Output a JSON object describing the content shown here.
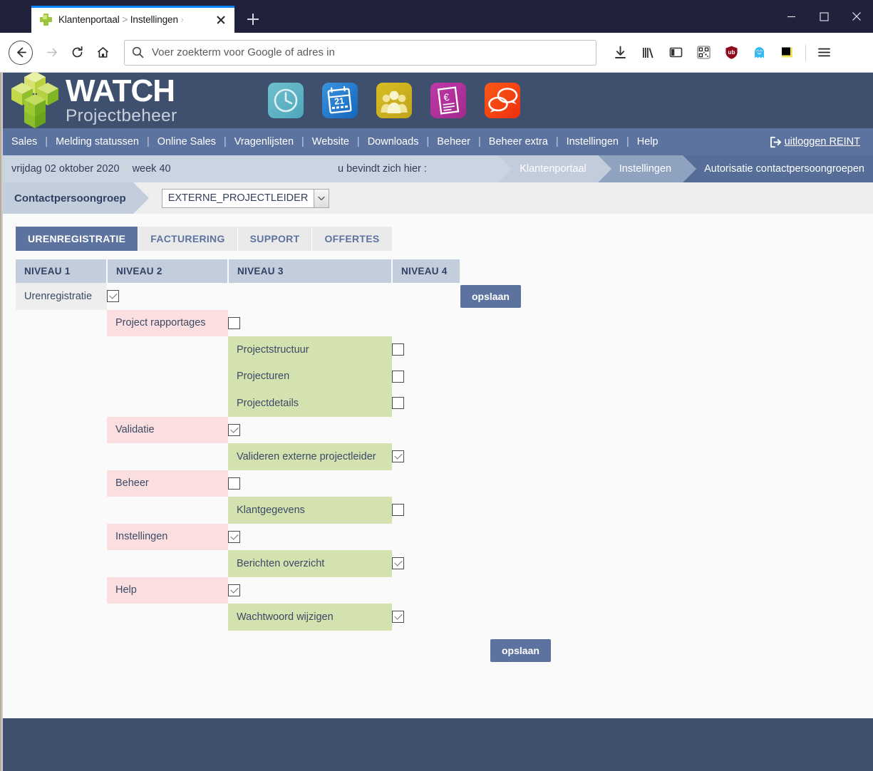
{
  "browser": {
    "tab": {
      "title_main": "Klantenportaal",
      "separator": " > ",
      "title_sub": "Instellingen",
      "trailing": " ›",
      "favicon": "watch-logo-favicon",
      "close_label": "×",
      "newtab_label": "+"
    },
    "window": {
      "minimize": "–",
      "maximize": "☐",
      "close": "×"
    },
    "nav": {
      "back": "back-arrow",
      "forward": "forward-arrow",
      "reload": "reload-arrow",
      "home": "home-house"
    },
    "urlbar": {
      "placeholder": "Voer zoekterm voor Google of adres in",
      "value": ""
    },
    "toolbar_icons": [
      "downloads-icon",
      "library-icon",
      "sidebar-icon",
      "qrcode-icon",
      "ublock-origin-icon",
      "ghostery-icon",
      "blackbox-extension-icon",
      "hamburger-menu-icon"
    ]
  },
  "app": {
    "logo": {
      "line1": "WATCH",
      "line2": "Projectbeheer"
    },
    "quick_icons": [
      {
        "name": "clock-icon",
        "color": "#5fb3c4"
      },
      {
        "name": "calendar-icon",
        "color": "#2277c8",
        "day": "21"
      },
      {
        "name": "people-icon",
        "color": "#cdb021"
      },
      {
        "name": "invoice-euro-icon",
        "color": "#b4319b",
        "symbol": "€"
      },
      {
        "name": "chat-icon",
        "color": "#f4471a"
      }
    ],
    "menu": [
      "Sales",
      "Melding statussen",
      "Online Sales",
      "Vragenlijsten",
      "Website",
      "Downloads",
      "Beheer",
      "Beheer extra",
      "Instellingen",
      "Help"
    ],
    "menu_separator": "|",
    "logout": {
      "icon": "logout-icon",
      "label": " uitloggen REINT"
    },
    "statusbar": {
      "date": "vrijdag 02 oktober 2020",
      "week": "week 40",
      "here_label": "u bevindt zich hier :",
      "breadcrumbs": [
        "Klantenportaal",
        "Instellingen",
        "Autorisatie contactpersoongroepen"
      ]
    },
    "group": {
      "label": "Contactpersoongroep",
      "selected": "EXTERNE_PROJECTLEIDER",
      "options": [
        "EXTERNE_PROJECTLEIDER"
      ]
    },
    "tabs": [
      {
        "label": "URENREGISTRATIE",
        "active": true
      },
      {
        "label": "FACTURERING",
        "active": false
      },
      {
        "label": "SUPPORT",
        "active": false
      },
      {
        "label": "OFFERTES",
        "active": false
      }
    ],
    "table": {
      "headers": [
        "NIVEAU 1",
        "NIVEAU 2",
        "NIVEAU 3",
        "NIVEAU 4"
      ],
      "rows": [
        {
          "level": 1,
          "label": "Urenregistratie",
          "checked": true,
          "save_button": true
        },
        {
          "level": 2,
          "label": "Project rapportages",
          "checked": false
        },
        {
          "level": 3,
          "label": "Projectstructuur",
          "checked": false
        },
        {
          "level": 3,
          "label": "Projecturen",
          "checked": false
        },
        {
          "level": 3,
          "label": "Projectdetails",
          "checked": false
        },
        {
          "level": 2,
          "label": "Validatie",
          "checked": true
        },
        {
          "level": 3,
          "label": "Valideren externe projectleider",
          "checked": true
        },
        {
          "level": 2,
          "label": "Beheer",
          "checked": false
        },
        {
          "level": 3,
          "label": "Klantgegevens",
          "checked": false
        },
        {
          "level": 2,
          "label": "Instellingen",
          "checked": true
        },
        {
          "level": 3,
          "label": "Berichten overzicht",
          "checked": true
        },
        {
          "level": 2,
          "label": "Help",
          "checked": true
        },
        {
          "level": 3,
          "label": "Wachtwoord wijzigen",
          "checked": true
        }
      ],
      "save_label": "opslaan"
    },
    "colors": {
      "header_bg": "#3f4f6e",
      "menu_bg": "#5d739f",
      "crumb_bg": "#cbd5e2",
      "level2_bg": "#fbdfe0",
      "level3_bg": "#d4e2b0",
      "accent": "#5d739f"
    }
  }
}
